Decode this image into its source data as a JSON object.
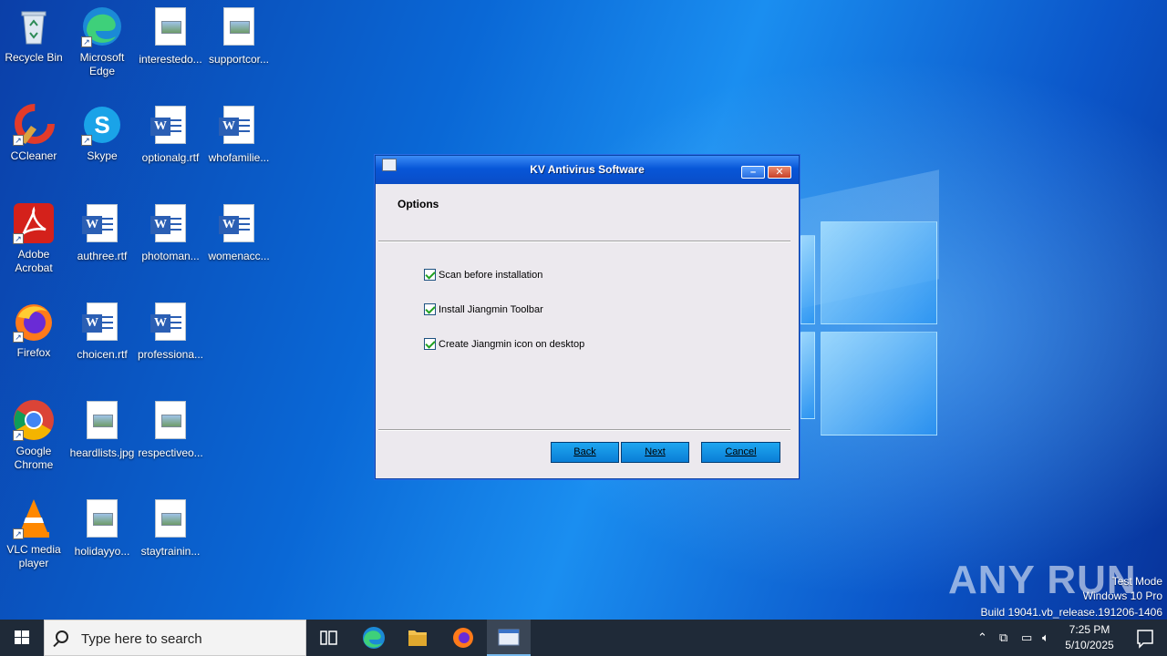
{
  "desktop": {
    "icons": [
      {
        "label": "Recycle Bin",
        "icon": "recycle-bin-icon"
      },
      {
        "label": "Microsoft Edge",
        "icon": "edge-icon"
      },
      {
        "label": "interestedo...",
        "icon": "image-file-icon"
      },
      {
        "label": "supportcor...",
        "icon": "image-file-icon"
      },
      {
        "label": "CCleaner",
        "icon": "ccleaner-icon"
      },
      {
        "label": "Skype",
        "icon": "skype-icon"
      },
      {
        "label": "optionalg.rtf",
        "icon": "word-file-icon"
      },
      {
        "label": "whofamilie...",
        "icon": "word-file-icon"
      },
      {
        "label": "Adobe Acrobat",
        "icon": "acrobat-icon"
      },
      {
        "label": "authree.rtf",
        "icon": "word-file-icon"
      },
      {
        "label": "photoman...",
        "icon": "word-file-icon"
      },
      {
        "label": "womenacc...",
        "icon": "word-file-icon"
      },
      {
        "label": "Firefox",
        "icon": "firefox-icon"
      },
      {
        "label": "choicen.rtf",
        "icon": "word-file-icon"
      },
      {
        "label": "professiona...",
        "icon": "word-file-icon"
      },
      {
        "label": "Google Chrome",
        "icon": "chrome-icon"
      },
      {
        "label": "heardlists.jpg",
        "icon": "image-file-icon"
      },
      {
        "label": "respectiveo...",
        "icon": "image-file-icon"
      },
      {
        "label": "VLC media player",
        "icon": "vlc-icon"
      },
      {
        "label": "holidayyo...",
        "icon": "image-file-icon"
      },
      {
        "label": "staytrainin...",
        "icon": "image-file-icon"
      }
    ]
  },
  "dialog": {
    "title": "KV Antivirus Software",
    "heading": "Options",
    "options": [
      {
        "label": "Scan before installation",
        "checked": true
      },
      {
        "label": "Install Jiangmin Toolbar",
        "checked": true
      },
      {
        "label": "Create Jiangmin icon on desktop",
        "checked": true
      }
    ],
    "buttons": {
      "back": "Back",
      "next": "Next",
      "cancel": "Cancel"
    }
  },
  "watermark": {
    "logo": "ANY RUN",
    "line1": "Test Mode",
    "line2": "Windows 10 Pro",
    "line3": "Build 19041.vb_release.191206-1406"
  },
  "taskbar": {
    "search_placeholder": "Type here to search",
    "time": "7:25 PM",
    "date": "5/10/2025"
  }
}
